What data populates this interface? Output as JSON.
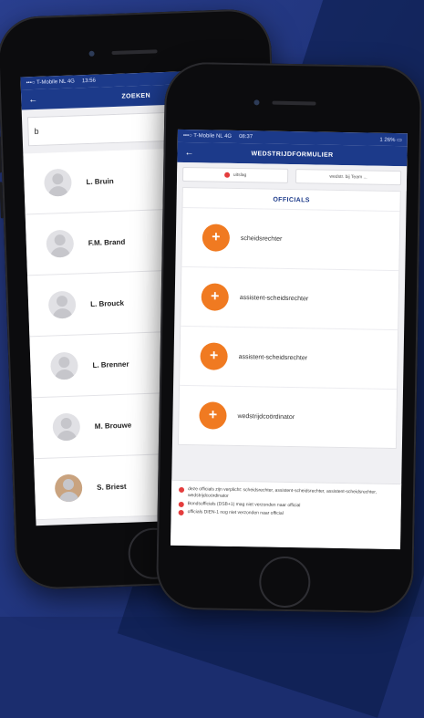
{
  "back_phone": {
    "status": {
      "carrier": "•••○ T-Mobile NL 4G",
      "time": "13:56"
    },
    "nav": {
      "back": "←",
      "title": "ZOEKEN"
    },
    "search": {
      "value": "b"
    },
    "people": [
      {
        "name": "L. Bruin",
        "avatar": "placeholder"
      },
      {
        "name": "F.M. Brand",
        "avatar": "placeholder"
      },
      {
        "name": "L. Brouck",
        "avatar": "placeholder"
      },
      {
        "name": "L. Brenner",
        "avatar": "placeholder"
      },
      {
        "name": "M. Brouwe",
        "avatar": "placeholder"
      },
      {
        "name": "S. Briest",
        "avatar": "photo"
      }
    ]
  },
  "front_phone": {
    "status": {
      "carrier": "•••○ T-Mobile NL 4G",
      "time": "08:37",
      "battery": "1 26% ▭"
    },
    "nav": {
      "back": "←",
      "title": "WEDSTRIJDFORMULIER"
    },
    "tabs": [
      {
        "label": "uitslag"
      },
      {
        "label": "wedstr. bij Team ..."
      }
    ],
    "card_title": "OFFICIALS",
    "roles": [
      {
        "label": "scheidsrechter"
      },
      {
        "label": "assistent-scheidsrechter"
      },
      {
        "label": "assistent-scheidsrechter"
      },
      {
        "label": "wedstrijdcoördinator"
      }
    ],
    "notes": [
      "deze officials zijn verplicht: scheidsrechter, assistent-scheidsrechter, assistent-scheidsrechter, wedstrijdcoördinator",
      "Bondsofficials (DSB+1) mag niet verzonden naar official",
      "officials DIEN-1 nog niet verzonden naar official"
    ],
    "colors": {
      "accent": "#f07a21",
      "brand": "#1c3a8a",
      "warning": "#e43d3d"
    }
  }
}
